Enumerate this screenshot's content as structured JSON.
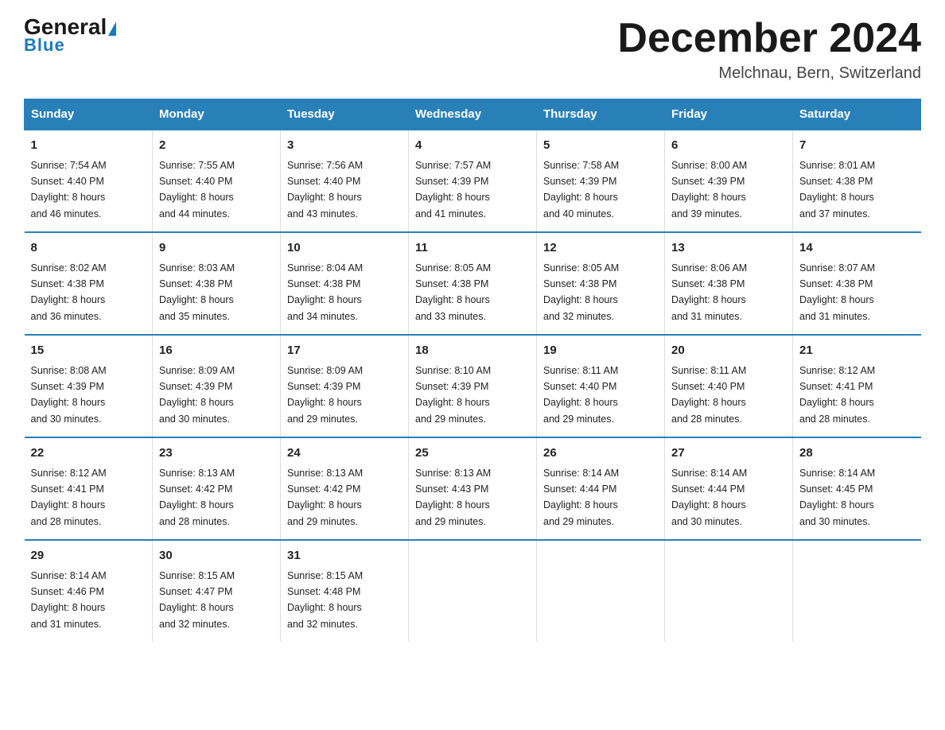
{
  "header": {
    "logo_general": "General",
    "logo_blue": "Blue",
    "title": "December 2024",
    "location": "Melchnau, Bern, Switzerland"
  },
  "days_of_week": [
    "Sunday",
    "Monday",
    "Tuesday",
    "Wednesday",
    "Thursday",
    "Friday",
    "Saturday"
  ],
  "weeks": [
    [
      {
        "day": "1",
        "sunrise": "7:54 AM",
        "sunset": "4:40 PM",
        "daylight": "8 hours and 46 minutes."
      },
      {
        "day": "2",
        "sunrise": "7:55 AM",
        "sunset": "4:40 PM",
        "daylight": "8 hours and 44 minutes."
      },
      {
        "day": "3",
        "sunrise": "7:56 AM",
        "sunset": "4:40 PM",
        "daylight": "8 hours and 43 minutes."
      },
      {
        "day": "4",
        "sunrise": "7:57 AM",
        "sunset": "4:39 PM",
        "daylight": "8 hours and 41 minutes."
      },
      {
        "day": "5",
        "sunrise": "7:58 AM",
        "sunset": "4:39 PM",
        "daylight": "8 hours and 40 minutes."
      },
      {
        "day": "6",
        "sunrise": "8:00 AM",
        "sunset": "4:39 PM",
        "daylight": "8 hours and 39 minutes."
      },
      {
        "day": "7",
        "sunrise": "8:01 AM",
        "sunset": "4:38 PM",
        "daylight": "8 hours and 37 minutes."
      }
    ],
    [
      {
        "day": "8",
        "sunrise": "8:02 AM",
        "sunset": "4:38 PM",
        "daylight": "8 hours and 36 minutes."
      },
      {
        "day": "9",
        "sunrise": "8:03 AM",
        "sunset": "4:38 PM",
        "daylight": "8 hours and 35 minutes."
      },
      {
        "day": "10",
        "sunrise": "8:04 AM",
        "sunset": "4:38 PM",
        "daylight": "8 hours and 34 minutes."
      },
      {
        "day": "11",
        "sunrise": "8:05 AM",
        "sunset": "4:38 PM",
        "daylight": "8 hours and 33 minutes."
      },
      {
        "day": "12",
        "sunrise": "8:05 AM",
        "sunset": "4:38 PM",
        "daylight": "8 hours and 32 minutes."
      },
      {
        "day": "13",
        "sunrise": "8:06 AM",
        "sunset": "4:38 PM",
        "daylight": "8 hours and 31 minutes."
      },
      {
        "day": "14",
        "sunrise": "8:07 AM",
        "sunset": "4:38 PM",
        "daylight": "8 hours and 31 minutes."
      }
    ],
    [
      {
        "day": "15",
        "sunrise": "8:08 AM",
        "sunset": "4:39 PM",
        "daylight": "8 hours and 30 minutes."
      },
      {
        "day": "16",
        "sunrise": "8:09 AM",
        "sunset": "4:39 PM",
        "daylight": "8 hours and 30 minutes."
      },
      {
        "day": "17",
        "sunrise": "8:09 AM",
        "sunset": "4:39 PM",
        "daylight": "8 hours and 29 minutes."
      },
      {
        "day": "18",
        "sunrise": "8:10 AM",
        "sunset": "4:39 PM",
        "daylight": "8 hours and 29 minutes."
      },
      {
        "day": "19",
        "sunrise": "8:11 AM",
        "sunset": "4:40 PM",
        "daylight": "8 hours and 29 minutes."
      },
      {
        "day": "20",
        "sunrise": "8:11 AM",
        "sunset": "4:40 PM",
        "daylight": "8 hours and 28 minutes."
      },
      {
        "day": "21",
        "sunrise": "8:12 AM",
        "sunset": "4:41 PM",
        "daylight": "8 hours and 28 minutes."
      }
    ],
    [
      {
        "day": "22",
        "sunrise": "8:12 AM",
        "sunset": "4:41 PM",
        "daylight": "8 hours and 28 minutes."
      },
      {
        "day": "23",
        "sunrise": "8:13 AM",
        "sunset": "4:42 PM",
        "daylight": "8 hours and 28 minutes."
      },
      {
        "day": "24",
        "sunrise": "8:13 AM",
        "sunset": "4:42 PM",
        "daylight": "8 hours and 29 minutes."
      },
      {
        "day": "25",
        "sunrise": "8:13 AM",
        "sunset": "4:43 PM",
        "daylight": "8 hours and 29 minutes."
      },
      {
        "day": "26",
        "sunrise": "8:14 AM",
        "sunset": "4:44 PM",
        "daylight": "8 hours and 29 minutes."
      },
      {
        "day": "27",
        "sunrise": "8:14 AM",
        "sunset": "4:44 PM",
        "daylight": "8 hours and 30 minutes."
      },
      {
        "day": "28",
        "sunrise": "8:14 AM",
        "sunset": "4:45 PM",
        "daylight": "8 hours and 30 minutes."
      }
    ],
    [
      {
        "day": "29",
        "sunrise": "8:14 AM",
        "sunset": "4:46 PM",
        "daylight": "8 hours and 31 minutes."
      },
      {
        "day": "30",
        "sunrise": "8:15 AM",
        "sunset": "4:47 PM",
        "daylight": "8 hours and 32 minutes."
      },
      {
        "day": "31",
        "sunrise": "8:15 AM",
        "sunset": "4:48 PM",
        "daylight": "8 hours and 32 minutes."
      },
      null,
      null,
      null,
      null
    ]
  ],
  "labels": {
    "sunrise": "Sunrise:",
    "sunset": "Sunset:",
    "daylight": "Daylight:"
  }
}
